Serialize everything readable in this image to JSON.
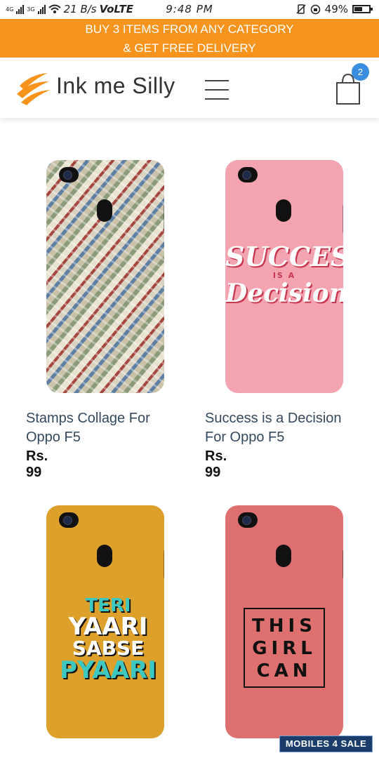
{
  "status_bar": {
    "network_left": "4G",
    "network_right": "3G",
    "speed": "21 B/s",
    "volte": "VoLTE",
    "time": "9:48 PM",
    "battery": "49%",
    "battery_level": 0.49
  },
  "promo": {
    "line1": "BUY 3 ITEMS FROM ANY CATEGORY",
    "line2": "& GET FREE DELIVERY"
  },
  "header": {
    "brand": "Ink me Silly",
    "cart_count": "2",
    "menu_icon": "hamburger-menu-icon",
    "cart_icon": "shopping-bag-icon"
  },
  "products": [
    {
      "title": "Stamps Collage For Oppo F5",
      "price": "Rs. 99"
    },
    {
      "title": "Success is a Decision For Oppo F5",
      "price": "Rs. 99",
      "art": {
        "w1": "SUCCESS",
        "w2": "IS A",
        "w3": "Decision"
      }
    },
    {
      "art": {
        "a": "TERI",
        "b": "YAARI",
        "c": "SABSE",
        "d": "PYAARI"
      }
    },
    {
      "art": {
        "l1": "THIS",
        "l2": "GIRL",
        "l3": "CAN"
      }
    }
  ],
  "watermark": "MOBILES 4 SALE",
  "colors": {
    "promo_bg": "#f7941d",
    "badge": "#3b8de0",
    "title_text": "#34495e"
  }
}
